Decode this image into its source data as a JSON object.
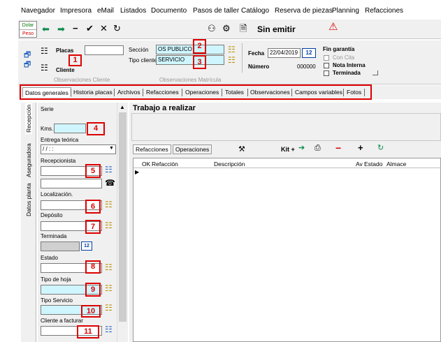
{
  "menu": [
    "Navegador",
    "Impresora",
    "eMail",
    "Listados",
    "Documento",
    "Pasos de taller",
    "Catálogo",
    "Reserva de piezas",
    "Planning",
    "Refacciones"
  ],
  "toolbar": {
    "currency_top": "Dolar",
    "currency_bottom": "Peso",
    "icons": [
      "arrow-left-icon",
      "arrow-right-icon",
      "minus-icon",
      "check-icon",
      "close-icon",
      "refresh-icon",
      "binoculars-icon",
      "tools-icon",
      "document-icon",
      "warning-icon"
    ],
    "sin_emitir": "Sin emitir"
  },
  "header": {
    "placas_label": "Placas",
    "cliente_label": "Cliente",
    "obs_cliente": "Observaciones Cliente",
    "seccion_label": "Sección",
    "seccion_value": "OS PUBLICO",
    "tipo_cliente_label": "Tipo cliente",
    "tipo_cliente_value": "SERVICIO",
    "obs_matricula": "Observaciones Matrícula",
    "fecha_label": "Fecha",
    "fecha_value": "22/04/2019",
    "numero_label": "Número",
    "numero_value": "000000",
    "fin_garantia": "Fin garantía",
    "con_cita": "Con Cita",
    "nota_interna": "Nota Interna",
    "terminada": "Terminada"
  },
  "tabs": [
    "Datos generales",
    "Historia placas",
    "Archivos",
    "Refacciones",
    "Operaciones",
    "Totales",
    "Observaciones",
    "Campos variables",
    "Fotos"
  ],
  "vertical_tabs": [
    "Recepción",
    "Aseguradora",
    "Datos planta"
  ],
  "left_fields": {
    "serie": "Serie",
    "kms": "Kms.",
    "entrega": "Entrega teórica",
    "entrega_value": " / /    : :",
    "recepcionista": "Recepcionista",
    "localizacion": "Localización.",
    "deposito": "Depósito",
    "terminada": "Terminada",
    "estado": "Estado",
    "tipo_hoja": "Tipo de hoja",
    "tipo_servicio": "Tipo Servicio",
    "cliente_facturar": "Cliente a facturar"
  },
  "callouts": [
    "1",
    "2",
    "3",
    "4",
    "5",
    "6",
    "7",
    "8",
    "9",
    "10",
    "11"
  ],
  "work": {
    "title": "Trabajo a realizar",
    "subtab_refacciones": "Refacciones",
    "subtab_operaciones": "Operaciones",
    "kit": "Kit +",
    "plus": "+",
    "minus": "−",
    "columns": [
      "OK",
      "Refacción",
      "Descripción",
      "Av",
      "Estado",
      "Almace"
    ]
  },
  "colors": {
    "callout": "#dd0000",
    "cyan_field": "#cff6ff",
    "panel": "#f0f0f0"
  }
}
